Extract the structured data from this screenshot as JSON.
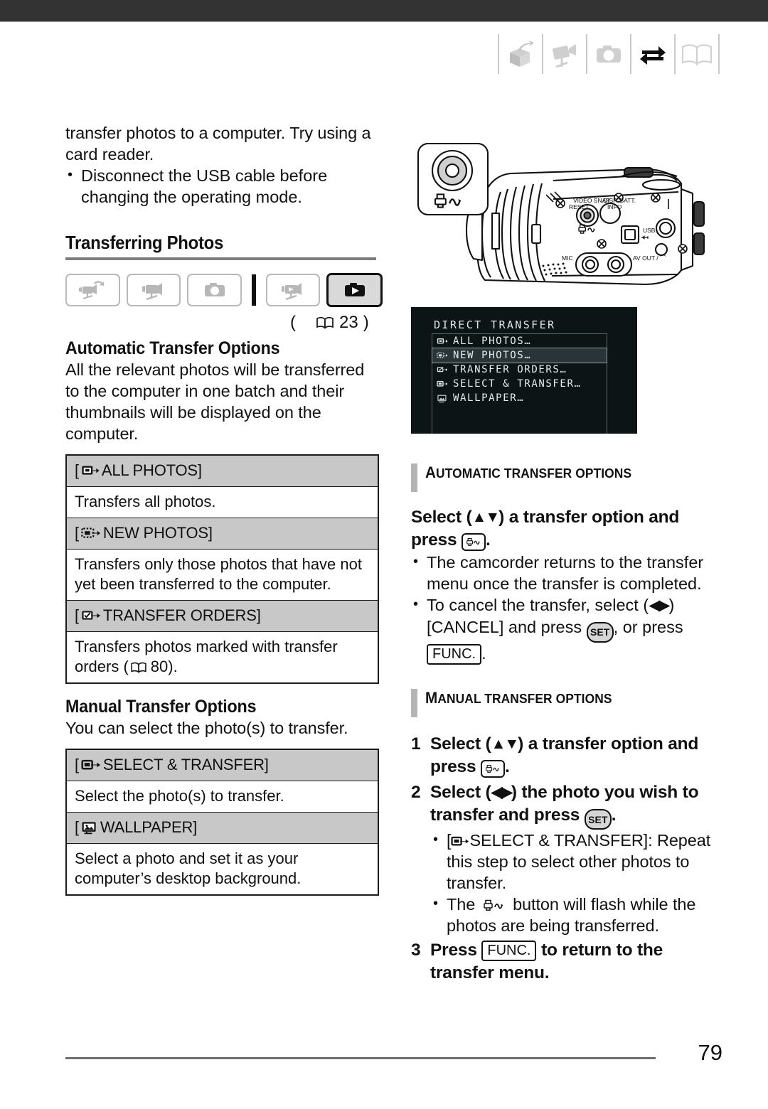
{
  "page": {
    "number": "79"
  },
  "header": {
    "icons": [
      {
        "name": "unbox-icon",
        "active": false
      },
      {
        "name": "camcorder-icon",
        "active": false
      },
      {
        "name": "photo-camera-icon",
        "active": false
      },
      {
        "name": "transfer-arrows-icon",
        "active": true
      },
      {
        "name": "open-book-icon",
        "active": false
      }
    ]
  },
  "left": {
    "intro_text": "transfer photos to a computer. Try using a card reader.",
    "intro_bullets": [
      "Disconnect the USB cable before changing the operating mode."
    ],
    "section_title": "Transferring Photos",
    "mode_icons": [
      {
        "name": "dual-shot-mode-icon",
        "selected": false
      },
      {
        "name": "movie-record-mode-icon",
        "selected": false
      },
      {
        "name": "photo-record-mode-icon",
        "selected": false
      },
      {
        "name": "movie-play-mode-icon",
        "selected": false
      },
      {
        "name": "photo-play-mode-icon",
        "selected": true
      }
    ],
    "page_ref": "23",
    "auto_heading": "Automatic Transfer Options",
    "auto_body": "All the relevant photos will be transferred to the computer in one batch and their thumbnails will be displayed on the computer.",
    "auto_table": [
      {
        "icon": "all-photos-icon",
        "label": "[ ALL PHOTOS]",
        "label_pre": "[",
        "label_text": "ALL PHOTOS]",
        "desc": "Transfers all photos."
      },
      {
        "icon": "new-photos-icon",
        "label_pre": "[",
        "label_text": "NEW PHOTOS]",
        "desc": "Transfers only those photos that have not yet been transferred to the computer."
      },
      {
        "icon": "transfer-orders-icon",
        "label_pre": "[",
        "label_text": "TRANSFER ORDERS]",
        "desc": "Transfers photos marked with transfer orders (",
        "desc_ref": "80",
        "desc_tail": ")."
      }
    ],
    "manual_heading": "Manual Transfer Options",
    "manual_body": "You can select the photo(s) to transfer.",
    "manual_table": [
      {
        "icon": "select-transfer-icon",
        "label_pre": "[",
        "label_text": "SELECT & TRANSFER]",
        "desc": "Select the photo(s) to transfer."
      },
      {
        "icon": "wallpaper-icon",
        "label_pre": "[",
        "label_text": "WALLPAPER]",
        "desc": "Select a photo and set it as your computer’s desktop background."
      }
    ]
  },
  "camcorder": {
    "callout_button_label": "print-share-button",
    "labels": {
      "video_snap": "VIDEO SNAP",
      "reset": "RESET",
      "disp_batt": "DISP./BATT.",
      "info": "INFO",
      "usb": "USB",
      "mic": "MIC",
      "av_out": "AV OUT /"
    }
  },
  "lcd": {
    "title": "DIRECT TRANSFER",
    "items": [
      {
        "icon": "all-photos-icon",
        "label": "ALL PHOTOS…",
        "highlighted": false
      },
      {
        "icon": "new-photos-icon",
        "label": "NEW PHOTOS…",
        "highlighted": true
      },
      {
        "icon": "transfer-orders-icon",
        "label": "TRANSFER ORDERS…",
        "highlighted": false
      },
      {
        "icon": "select-transfer-icon",
        "label": "SELECT & TRANSFER…",
        "highlighted": false
      },
      {
        "icon": "wallpaper-icon",
        "label": "WALLPAPER…",
        "highlighted": false
      }
    ]
  },
  "right": {
    "auto_heading_first": "A",
    "auto_heading_rest": "UTOMATIC TRANSFER OPTIONS",
    "auto_step_a": "Select (",
    "auto_step_b": ") a transfer option and press",
    "auto_bullets": [
      "The camcorder returns to the transfer menu once the transfer is completed.",
      "To cancel the transfer, select ("
    ],
    "cancel_tail_a": ") [CANCEL] and press",
    "cancel_tail_b": ", or press",
    "manual_heading_first": "M",
    "manual_heading_rest": "ANUAL TRANSFER OPTIONS",
    "step1_num": "1",
    "step1_a": "Select (",
    "step1_b": ") a transfer option and press",
    "step2_num": "2",
    "step2_a": "Select (",
    "step2_b": ") the photo you wish to transfer and press",
    "step2_bullets": [
      "[ SELECT & TRANSFER]: Repeat this step to select other photos to transfer.",
      "The  button will flash while the photos are being transferred."
    ],
    "step2_bullet1_pre": "[",
    "step2_bullet1_post": "SELECT & TRANSFER]: Repeat this step to select other photos to transfer.",
    "step2_bullet2_pre": "The",
    "step2_bullet2_post": "button will flash while the photos are being transferred.",
    "step3_num": "3",
    "step3_a": "Press",
    "step3_b": "to return to the transfer menu.",
    "func_label": "FUNC.",
    "set_label": "SET",
    "up_down": "▲▼",
    "left_right": "◀▶"
  }
}
